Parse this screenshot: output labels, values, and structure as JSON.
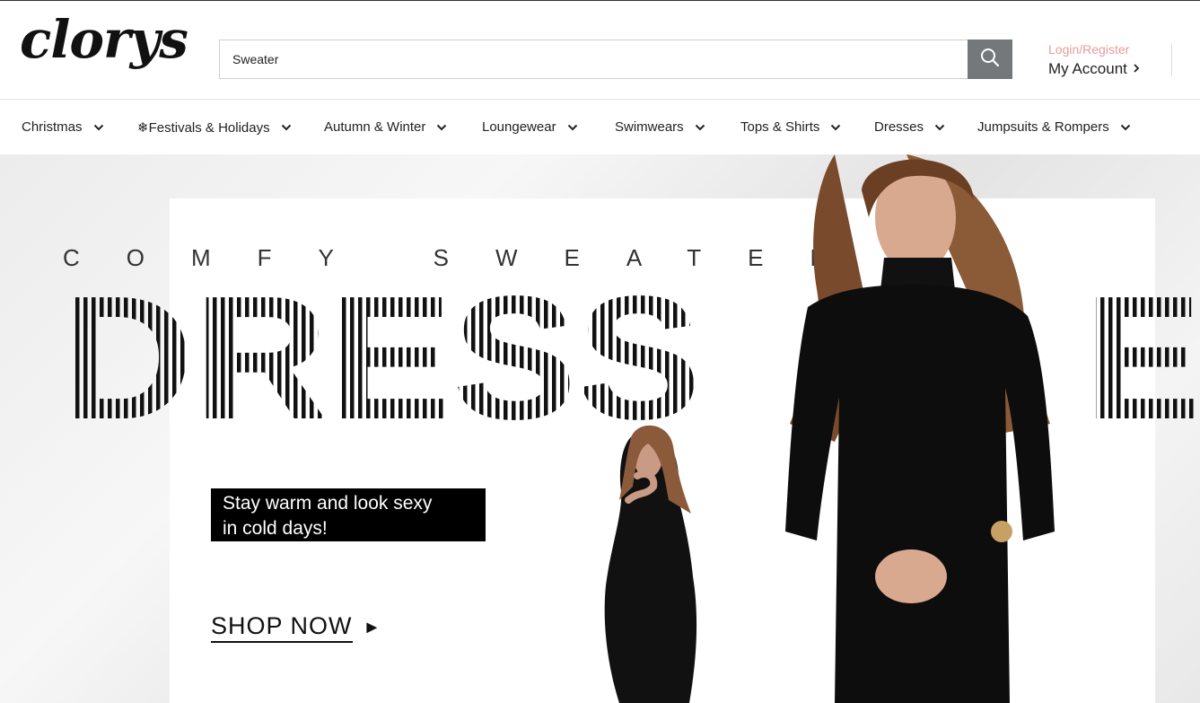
{
  "brand": {
    "logo_text": "clorys"
  },
  "search": {
    "value": "Sweater",
    "placeholder": ""
  },
  "account": {
    "login_label": "Login/Register",
    "account_label": "My Account"
  },
  "nav": {
    "items": [
      {
        "label": "Christmas"
      },
      {
        "label": "❄Festivals & Holidays"
      },
      {
        "label": "Autumn & Winter"
      },
      {
        "label": "Loungewear"
      },
      {
        "label": "Swimwears"
      },
      {
        "label": "Tops & Shirts"
      },
      {
        "label": "Dresses"
      },
      {
        "label": "Jumpsuits & Rompers"
      }
    ]
  },
  "hero": {
    "subtitle": "COMFY SWEATER",
    "headline": "DRESS",
    "headline_right": "E",
    "tagline_line1": "Stay warm and look sexy",
    "tagline_line2": "in cold days!",
    "cta_label": "SHOP NOW",
    "cta_arrow": "►"
  },
  "colors": {
    "accent_login": "#e89b9b",
    "search_button": "#75787b",
    "text_dark": "#222222"
  },
  "icons": {
    "search": "search-icon",
    "chevron_right": "chevron-right-icon",
    "chevron_down": "chevron-down-icon",
    "play_arrow": "play-arrow-icon"
  }
}
